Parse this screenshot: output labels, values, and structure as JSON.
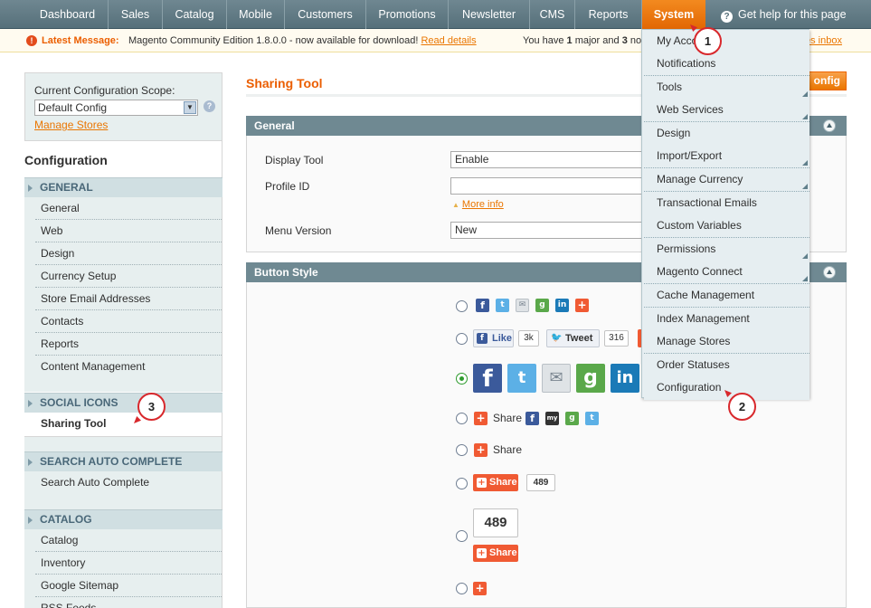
{
  "topnav": {
    "items": [
      "Dashboard",
      "Sales",
      "Catalog",
      "Mobile",
      "Customers",
      "Promotions",
      "Newsletter",
      "CMS",
      "Reports",
      "System"
    ],
    "active": "System",
    "help": "Get help for this page"
  },
  "message": {
    "title": "Latest Message:",
    "text": "Magento Community Edition 1.8.0.0 - now available for download!",
    "link": "Read details",
    "right_pre": "You have ",
    "right_count": "1",
    "right_mid": " major and ",
    "right_count2": "3",
    "right_post": " not",
    "inbox": "es inbox"
  },
  "scope": {
    "label": "Current Configuration Scope:",
    "value": "Default Config",
    "manage": "Manage Stores"
  },
  "sidebar": {
    "title": "Configuration",
    "groups": [
      {
        "heading": "GENERAL",
        "items": [
          "General",
          "Web",
          "Design",
          "Currency Setup",
          "Store Email Addresses",
          "Contacts",
          "Reports",
          "Content Management"
        ]
      },
      {
        "heading": "SOCIAL ICONS",
        "items": [
          "Sharing Tool"
        ]
      },
      {
        "heading": "SEARCH AUTO COMPLETE",
        "items": [
          "Search Auto Complete"
        ]
      },
      {
        "heading": "CATALOG",
        "items": [
          "Catalog",
          "Inventory",
          "Google Sitemap",
          "RSS Feeds"
        ]
      }
    ]
  },
  "main": {
    "title": "Sharing Tool",
    "save_button": "onfig",
    "general": {
      "heading": "General",
      "display_tool_label": "Display Tool",
      "display_tool_value": "Enable",
      "profile_id_label": "Profile ID",
      "profile_id_value": "",
      "more_info": "More info",
      "menu_version_label": "Menu Version",
      "menu_version_value": "New"
    },
    "button_style": {
      "heading": "Button Style",
      "like_label": "Like",
      "like_count": "3k",
      "tweet_label": "Tweet",
      "tweet_count": "316",
      "share_label": "Share",
      "share_count": "489",
      "big_count": "489"
    }
  },
  "system_menu": {
    "items": [
      {
        "label": "My Account",
        "sub": false
      },
      {
        "label": "Notifications",
        "sub": false
      },
      {
        "label": "Tools",
        "sub": true
      },
      {
        "label": "Web Services",
        "sub": true
      },
      {
        "label": "Design",
        "sub": false
      },
      {
        "label": "Import/Export",
        "sub": true
      },
      {
        "label": "Manage Currency",
        "sub": true
      },
      {
        "label": "Transactional Emails",
        "sub": false
      },
      {
        "label": "Custom Variables",
        "sub": false
      },
      {
        "label": "Permissions",
        "sub": true
      },
      {
        "label": "Magento Connect",
        "sub": true
      },
      {
        "label": "Cache Management",
        "sub": false
      },
      {
        "label": "Index Management",
        "sub": false
      },
      {
        "label": "Manage Stores",
        "sub": false
      },
      {
        "label": "Order Statuses",
        "sub": false
      },
      {
        "label": "Configuration",
        "sub": false
      }
    ]
  },
  "callouts": [
    "1",
    "2",
    "3"
  ],
  "colors": {
    "accent": "#ea7601",
    "nav": "#5f7a84",
    "active_nav": "#e26703"
  }
}
